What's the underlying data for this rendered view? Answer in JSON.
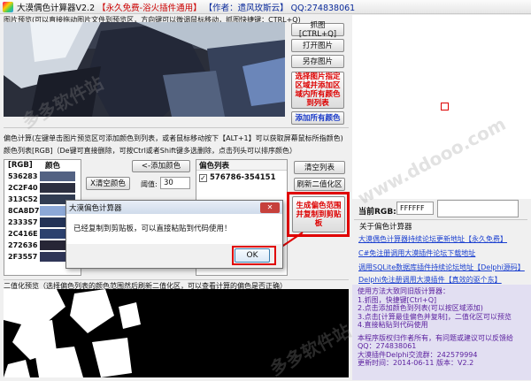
{
  "window": {
    "title_main": "大漠偶色计算器V2.2",
    "title_free": "【永久免费-浴火插件通用】",
    "title_author": "【作者：遗风玫斯云】",
    "title_qq": "QQ:274838061",
    "min_btn": "—",
    "max_btn": "□",
    "close_btn": "✕"
  },
  "preview": {
    "hint": "图片预览(可以直接拖动图片文件到预览区，方向键可以微调鼠标移动，抓图快捷键：CTRL+Q)",
    "buttons": {
      "capture": "抓图[CTRL+Q]",
      "open": "打开图片",
      "save_as": "另存图片",
      "select_area": "选择图片指定区域并添加区域内所有颜色到列表",
      "add_all": "添加所有颜色"
    }
  },
  "calc": {
    "hint_line1": "偏色计算(左键单击图片预览区可添加颜色到列表，或者鼠标移动按下【ALT+1】可以获取屏幕鼠标所指颜色)",
    "hint_line2": "颜色列表[RGB]（De键可直接删除，可按Ctrl或者Shift键多选删除，点击列头可以排序颜色）",
    "table_headers": {
      "rgb": "[RGB]",
      "color": "颜色"
    },
    "colors": [
      {
        "code": "536283",
        "hex": "#536283"
      },
      {
        "code": "2C2F40",
        "hex": "#2C2F40"
      },
      {
        "code": "313C52",
        "hex": "#313C52"
      },
      {
        "code": "8CA8D7",
        "hex": "#8CA8D7"
      },
      {
        "code": "2333S7",
        "hex": "#233357"
      },
      {
        "code": "2C416E",
        "hex": "#2C416E"
      },
      {
        "code": "272636",
        "hex": "#272636"
      },
      {
        "code": "2F3557",
        "hex": "#2F3557"
      }
    ],
    "add_color_btn": "<-添加颜色",
    "clear_color_btn": "X清空颜色",
    "threshold_label": "阈值:",
    "threshold_value": "30",
    "offset_list_header": "偏色列表",
    "offset_item": "576786-354151",
    "offset_item_checked": "✓",
    "clear_list_btn": "清空列表",
    "refresh_binary_btn": "刷新二值化区",
    "generate_btn": "生成偏色范围并复制到剪贴板"
  },
  "dialog": {
    "title": "大漠偏色计算器",
    "close": "✕",
    "message": "已经复制到剪贴板，可以直接粘贴到代码使用！",
    "ok": "OK"
  },
  "binary": {
    "hint": "二值化预览（选择偏色列表的颜色范围然后刷新二值化区，可以查看计算的偏色是否正确）"
  },
  "right": {
    "current_rgb_label": "当前RGB:",
    "current_rgb_value": "FFFFFF",
    "about_title": "关于偏色计算器",
    "links": [
      "大漠偶色计算器持续论坛更新地址【永久免费】",
      "C#免注册调用大漠插件论坛下载地址",
      "调用SQLite数据库插件持续论坛地址【Delphi源码】",
      "Delphi免注册调用大漠插件【真效的驱个东】"
    ],
    "usage_title": "使用方法大致同旧版计算器：",
    "usage_steps": [
      "1.抓图，快捷键[Ctrl+Q]",
      "2.点击添加颜色到列表(可以按区域添加)",
      "3.点击[计算最佳偏色并复制]，二值化区可以预览",
      "4.直接粘贴到代码使用"
    ],
    "copyright": "本程序版权归作者所有，有问题或建议可以反馈给",
    "qq": "QQ：274838061",
    "group": "大漠插件Delphi交流群：242579994",
    "version": "更新时间：2014-06-11 版本：V2.2"
  },
  "watermarks": [
    "多多软件站",
    "www.ddooo.com",
    "多多软件站"
  ],
  "accent": {
    "red": "#d00000",
    "blue": "#1b40d0",
    "purple": "#5a1f9e"
  }
}
